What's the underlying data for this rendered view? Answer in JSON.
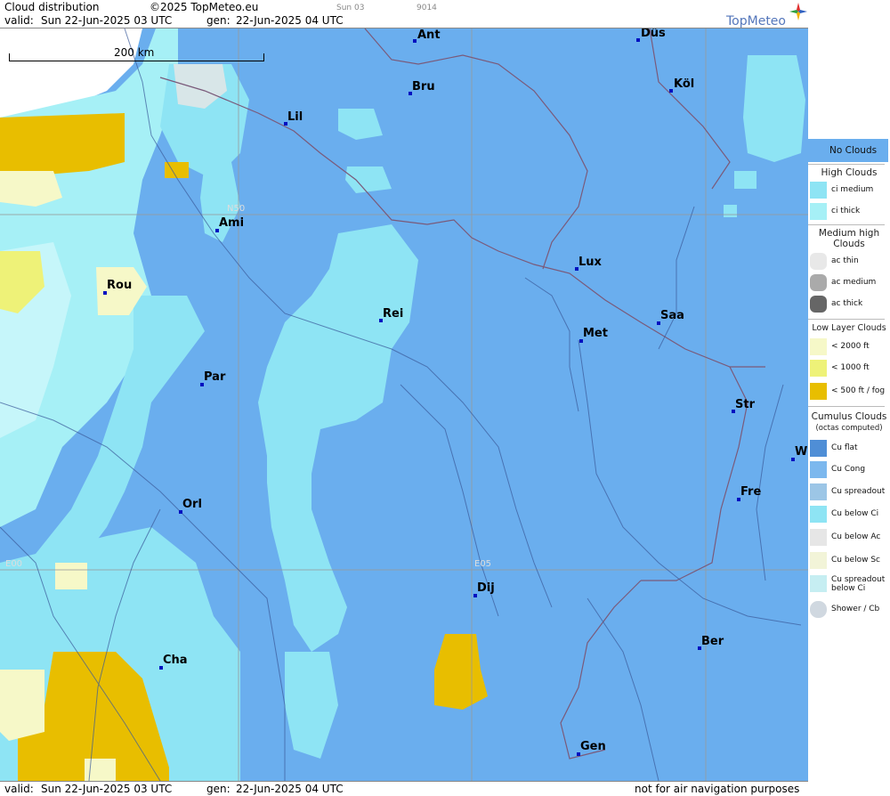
{
  "header": {
    "title": "Cloud distribution",
    "copyright": "©2025 TopMeteo.eu",
    "run_label": "Sun 03",
    "code": "9014",
    "valid_label": "valid:",
    "valid_value": "Sun  22-Jun-2025  03 UTC",
    "gen_label": "gen:",
    "gen_value": "22-Jun-2025 04 UTC",
    "brand": "TopMeteo"
  },
  "footer": {
    "valid_label": "valid:",
    "valid_value": "Sun  22-Jun-2025  03 UTC",
    "gen_label": "gen:",
    "gen_value": "22-Jun-2025 04 UTC",
    "disclaimer": "not for air navigation purposes"
  },
  "map": {
    "scale_label": "200 km",
    "grid_labels": {
      "n50": "N50",
      "e00": "E00",
      "e05": "E05"
    },
    "cities": [
      {
        "name": "Ant"
      },
      {
        "name": "Düs"
      },
      {
        "name": "Bru"
      },
      {
        "name": "Köl"
      },
      {
        "name": "Lil"
      },
      {
        "name": "Ami"
      },
      {
        "name": "Rou"
      },
      {
        "name": "Rei"
      },
      {
        "name": "Lux"
      },
      {
        "name": "Met"
      },
      {
        "name": "Saa"
      },
      {
        "name": "Par"
      },
      {
        "name": "Str"
      },
      {
        "name": "W"
      },
      {
        "name": "Orl"
      },
      {
        "name": "Fre"
      },
      {
        "name": "Dij"
      },
      {
        "name": "Ber"
      },
      {
        "name": "Cha"
      },
      {
        "name": "Gen"
      }
    ]
  },
  "legend": {
    "no_clouds": "No Clouds",
    "high_title": "High Clouds",
    "ci_medium": "ci medium",
    "ci_thick": "ci thick",
    "medium_title": "Medium high Clouds",
    "ac_thin": "ac thin",
    "ac_medium": "ac medium",
    "ac_thick": "ac thick",
    "low_title": "Low Layer Clouds",
    "low_2000": "< 2000 ft",
    "low_1000": "< 1000 ft",
    "low_500": "< 500 ft / fog",
    "cu_title": "Cumulus Clouds",
    "cu_sub": "(octas computed)",
    "cu_flat": "Cu flat",
    "cu_cong": "Cu Cong",
    "cu_spread": "Cu spreadout",
    "cu_below_ci": "Cu below Ci",
    "cu_below_ac": "Cu below Ac",
    "cu_below_sc": "Cu below Sc",
    "cu_spread_ci": "Cu spreadout below Ci",
    "shower": "Shower / Cb"
  },
  "colors": {
    "no_clouds": "#6aaeee",
    "ci_medium": "#8ee4f4",
    "ci_thick": "#a6f0f6",
    "low_2000": "#f6f8c8",
    "low_1000": "#eef278",
    "low_500": "#e8be00"
  }
}
